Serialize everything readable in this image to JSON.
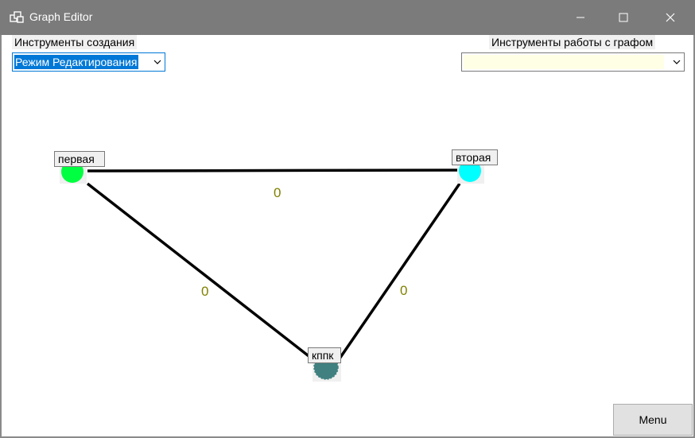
{
  "window": {
    "title": "Graph Editor",
    "icon": "app-window-icon",
    "controls": [
      "minimize-icon",
      "maximize-icon",
      "close-icon"
    ]
  },
  "toolbar": {
    "creation_tools_label": "Инструменты создания",
    "creation_mode_value": "Режим Редактирования",
    "graph_tools_label": "Инструменты работы с графом",
    "graph_tools_value": ""
  },
  "graph": {
    "nodes": [
      {
        "id": "first",
        "label": "первая",
        "color": "#00ff40"
      },
      {
        "id": "second",
        "label": "вторая",
        "color": "#00ffff"
      },
      {
        "id": "third",
        "label": "кппк",
        "color": "#408080"
      }
    ],
    "edges": [
      {
        "from": "first",
        "to": "second",
        "weight": "0"
      },
      {
        "from": "first",
        "to": "third",
        "weight": "0"
      },
      {
        "from": "second",
        "to": "third",
        "weight": "0"
      }
    ]
  },
  "footer": {
    "menu_label": "Menu"
  }
}
